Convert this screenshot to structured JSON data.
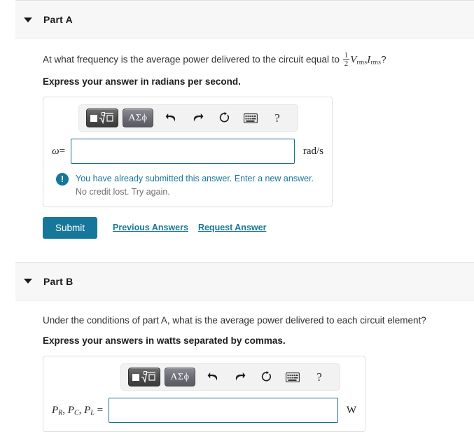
{
  "parts": [
    {
      "id": "A",
      "title": "Part A",
      "caret_icon": "caret-down-icon",
      "question_prefix": "At what frequency is the average power delivered to the circuit equal to ",
      "math": {
        "fraction_numerator": "1",
        "fraction_denominator": "2",
        "term1_var": "V",
        "term1_sub": "rms",
        "term2_var": "I",
        "term2_sub": "rms"
      },
      "question_suffix": "?",
      "prompt": "Express your answer in radians per second.",
      "input_label_var": "ω",
      "input_label_eq": "=",
      "input_value": "",
      "unit": "rad/s",
      "feedback": {
        "icon": "exclamation-circle-icon",
        "line1": "You have already submitted this answer. Enter a new answer.",
        "line2": "No credit lost. Try again."
      },
      "actions": {
        "submit_label": "Submit",
        "previous_answers_label": "Previous Answers",
        "request_answer_label": "Request Answer"
      }
    },
    {
      "id": "B",
      "title": "Part B",
      "caret_icon": "caret-down-icon",
      "question": "Under the conditions of part A, what is the average power delivered to each circuit element?",
      "prompt": "Express your answers in watts separated by commas.",
      "input_label_terms": [
        {
          "var": "P",
          "sub": "R"
        },
        {
          "var": "P",
          "sub": "C"
        },
        {
          "var": "P",
          "sub": "L"
        }
      ],
      "input_label_eq": "=",
      "input_value": "",
      "unit": "W"
    }
  ],
  "toolbar": {
    "buttons": [
      {
        "name": "math-template-button",
        "label": ""
      },
      {
        "name": "greek-symbols-button",
        "label": "ΑΣϕ"
      }
    ],
    "icons": [
      {
        "name": "undo-icon",
        "label": "undo"
      },
      {
        "name": "redo-icon",
        "label": "redo"
      },
      {
        "name": "reset-icon",
        "label": "reset"
      },
      {
        "name": "keyboard-icon",
        "label": "keyboard"
      },
      {
        "name": "help-icon",
        "label": "?"
      }
    ],
    "help_glyph": "?"
  },
  "colors": {
    "accent_teal": "#17779b",
    "input_border": "#1d6f8b",
    "header_bg": "#f7f7f7",
    "toolbar_bg": "#f2f2f2",
    "muted_text": "#6e6e6e"
  }
}
